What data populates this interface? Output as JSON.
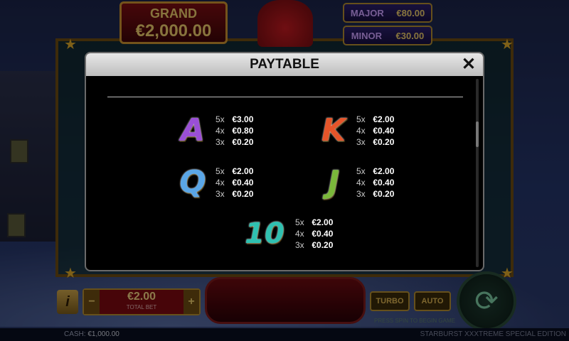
{
  "background": {
    "jackpots": {
      "grand_label": "GRAND",
      "grand_value": "€2,000.00",
      "major_label": "MAJOR",
      "major_value": "€80.00",
      "minor_label": "MINOR",
      "minor_value": "€30.00"
    },
    "controls": {
      "info_label": "i",
      "bet_value": "€2.00",
      "bet_label": "TOTAL BET",
      "minus_label": "−",
      "plus_label": "+",
      "turbo_label": "TURBO",
      "auto_label": "AUTO",
      "hint": "PRESS SPIN TO BEGIN GAME"
    },
    "footer": {
      "cash_label": "CASH:",
      "cash_value": "€1,000.00",
      "game_name": "STARBURST XXXTREME SPECIAL EDITION"
    }
  },
  "paytable": {
    "title": "PAYTABLE",
    "close_label": "✕",
    "symbols": [
      {
        "symbol": "A",
        "color": "#9a4fd6",
        "pays": [
          {
            "count": "5x",
            "amount": "€3.00"
          },
          {
            "count": "4x",
            "amount": "€0.80"
          },
          {
            "count": "3x",
            "amount": "€0.20"
          }
        ]
      },
      {
        "symbol": "K",
        "color": "#e6552a",
        "pays": [
          {
            "count": "5x",
            "amount": "€2.00"
          },
          {
            "count": "4x",
            "amount": "€0.40"
          },
          {
            "count": "3x",
            "amount": "€0.20"
          }
        ]
      },
      {
        "symbol": "Q",
        "color": "#5aa6e6",
        "pays": [
          {
            "count": "5x",
            "amount": "€2.00"
          },
          {
            "count": "4x",
            "amount": "€0.40"
          },
          {
            "count": "3x",
            "amount": "€0.20"
          }
        ]
      },
      {
        "symbol": "J",
        "color": "#7ab83a",
        "pays": [
          {
            "count": "5x",
            "amount": "€2.00"
          },
          {
            "count": "4x",
            "amount": "€0.40"
          },
          {
            "count": "3x",
            "amount": "€0.20"
          }
        ]
      },
      {
        "symbol": "10",
        "color": "#2fc0b0",
        "pays": [
          {
            "count": "5x",
            "amount": "€2.00"
          },
          {
            "count": "4x",
            "amount": "€0.40"
          },
          {
            "count": "3x",
            "amount": "€0.20"
          }
        ]
      }
    ]
  }
}
